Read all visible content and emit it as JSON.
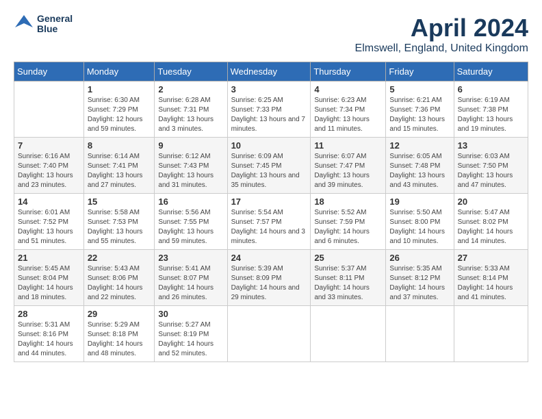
{
  "header": {
    "logo": {
      "line1": "General",
      "line2": "Blue"
    },
    "title": "April 2024",
    "location": "Elmswell, England, United Kingdom"
  },
  "weekdays": [
    "Sunday",
    "Monday",
    "Tuesday",
    "Wednesday",
    "Thursday",
    "Friday",
    "Saturday"
  ],
  "weeks": [
    [
      {
        "day": "",
        "info": ""
      },
      {
        "day": "1",
        "info": "Sunrise: 6:30 AM\nSunset: 7:29 PM\nDaylight: 12 hours\nand 59 minutes."
      },
      {
        "day": "2",
        "info": "Sunrise: 6:28 AM\nSunset: 7:31 PM\nDaylight: 13 hours\nand 3 minutes."
      },
      {
        "day": "3",
        "info": "Sunrise: 6:25 AM\nSunset: 7:33 PM\nDaylight: 13 hours\nand 7 minutes."
      },
      {
        "day": "4",
        "info": "Sunrise: 6:23 AM\nSunset: 7:34 PM\nDaylight: 13 hours\nand 11 minutes."
      },
      {
        "day": "5",
        "info": "Sunrise: 6:21 AM\nSunset: 7:36 PM\nDaylight: 13 hours\nand 15 minutes."
      },
      {
        "day": "6",
        "info": "Sunrise: 6:19 AM\nSunset: 7:38 PM\nDaylight: 13 hours\nand 19 minutes."
      }
    ],
    [
      {
        "day": "7",
        "info": "Sunrise: 6:16 AM\nSunset: 7:40 PM\nDaylight: 13 hours\nand 23 minutes."
      },
      {
        "day": "8",
        "info": "Sunrise: 6:14 AM\nSunset: 7:41 PM\nDaylight: 13 hours\nand 27 minutes."
      },
      {
        "day": "9",
        "info": "Sunrise: 6:12 AM\nSunset: 7:43 PM\nDaylight: 13 hours\nand 31 minutes."
      },
      {
        "day": "10",
        "info": "Sunrise: 6:09 AM\nSunset: 7:45 PM\nDaylight: 13 hours\nand 35 minutes."
      },
      {
        "day": "11",
        "info": "Sunrise: 6:07 AM\nSunset: 7:47 PM\nDaylight: 13 hours\nand 39 minutes."
      },
      {
        "day": "12",
        "info": "Sunrise: 6:05 AM\nSunset: 7:48 PM\nDaylight: 13 hours\nand 43 minutes."
      },
      {
        "day": "13",
        "info": "Sunrise: 6:03 AM\nSunset: 7:50 PM\nDaylight: 13 hours\nand 47 minutes."
      }
    ],
    [
      {
        "day": "14",
        "info": "Sunrise: 6:01 AM\nSunset: 7:52 PM\nDaylight: 13 hours\nand 51 minutes."
      },
      {
        "day": "15",
        "info": "Sunrise: 5:58 AM\nSunset: 7:53 PM\nDaylight: 13 hours\nand 55 minutes."
      },
      {
        "day": "16",
        "info": "Sunrise: 5:56 AM\nSunset: 7:55 PM\nDaylight: 13 hours\nand 59 minutes."
      },
      {
        "day": "17",
        "info": "Sunrise: 5:54 AM\nSunset: 7:57 PM\nDaylight: 14 hours\nand 3 minutes."
      },
      {
        "day": "18",
        "info": "Sunrise: 5:52 AM\nSunset: 7:59 PM\nDaylight: 14 hours\nand 6 minutes."
      },
      {
        "day": "19",
        "info": "Sunrise: 5:50 AM\nSunset: 8:00 PM\nDaylight: 14 hours\nand 10 minutes."
      },
      {
        "day": "20",
        "info": "Sunrise: 5:47 AM\nSunset: 8:02 PM\nDaylight: 14 hours\nand 14 minutes."
      }
    ],
    [
      {
        "day": "21",
        "info": "Sunrise: 5:45 AM\nSunset: 8:04 PM\nDaylight: 14 hours\nand 18 minutes."
      },
      {
        "day": "22",
        "info": "Sunrise: 5:43 AM\nSunset: 8:06 PM\nDaylight: 14 hours\nand 22 minutes."
      },
      {
        "day": "23",
        "info": "Sunrise: 5:41 AM\nSunset: 8:07 PM\nDaylight: 14 hours\nand 26 minutes."
      },
      {
        "day": "24",
        "info": "Sunrise: 5:39 AM\nSunset: 8:09 PM\nDaylight: 14 hours\nand 29 minutes."
      },
      {
        "day": "25",
        "info": "Sunrise: 5:37 AM\nSunset: 8:11 PM\nDaylight: 14 hours\nand 33 minutes."
      },
      {
        "day": "26",
        "info": "Sunrise: 5:35 AM\nSunset: 8:12 PM\nDaylight: 14 hours\nand 37 minutes."
      },
      {
        "day": "27",
        "info": "Sunrise: 5:33 AM\nSunset: 8:14 PM\nDaylight: 14 hours\nand 41 minutes."
      }
    ],
    [
      {
        "day": "28",
        "info": "Sunrise: 5:31 AM\nSunset: 8:16 PM\nDaylight: 14 hours\nand 44 minutes."
      },
      {
        "day": "29",
        "info": "Sunrise: 5:29 AM\nSunset: 8:18 PM\nDaylight: 14 hours\nand 48 minutes."
      },
      {
        "day": "30",
        "info": "Sunrise: 5:27 AM\nSunset: 8:19 PM\nDaylight: 14 hours\nand 52 minutes."
      },
      {
        "day": "",
        "info": ""
      },
      {
        "day": "",
        "info": ""
      },
      {
        "day": "",
        "info": ""
      },
      {
        "day": "",
        "info": ""
      }
    ]
  ]
}
